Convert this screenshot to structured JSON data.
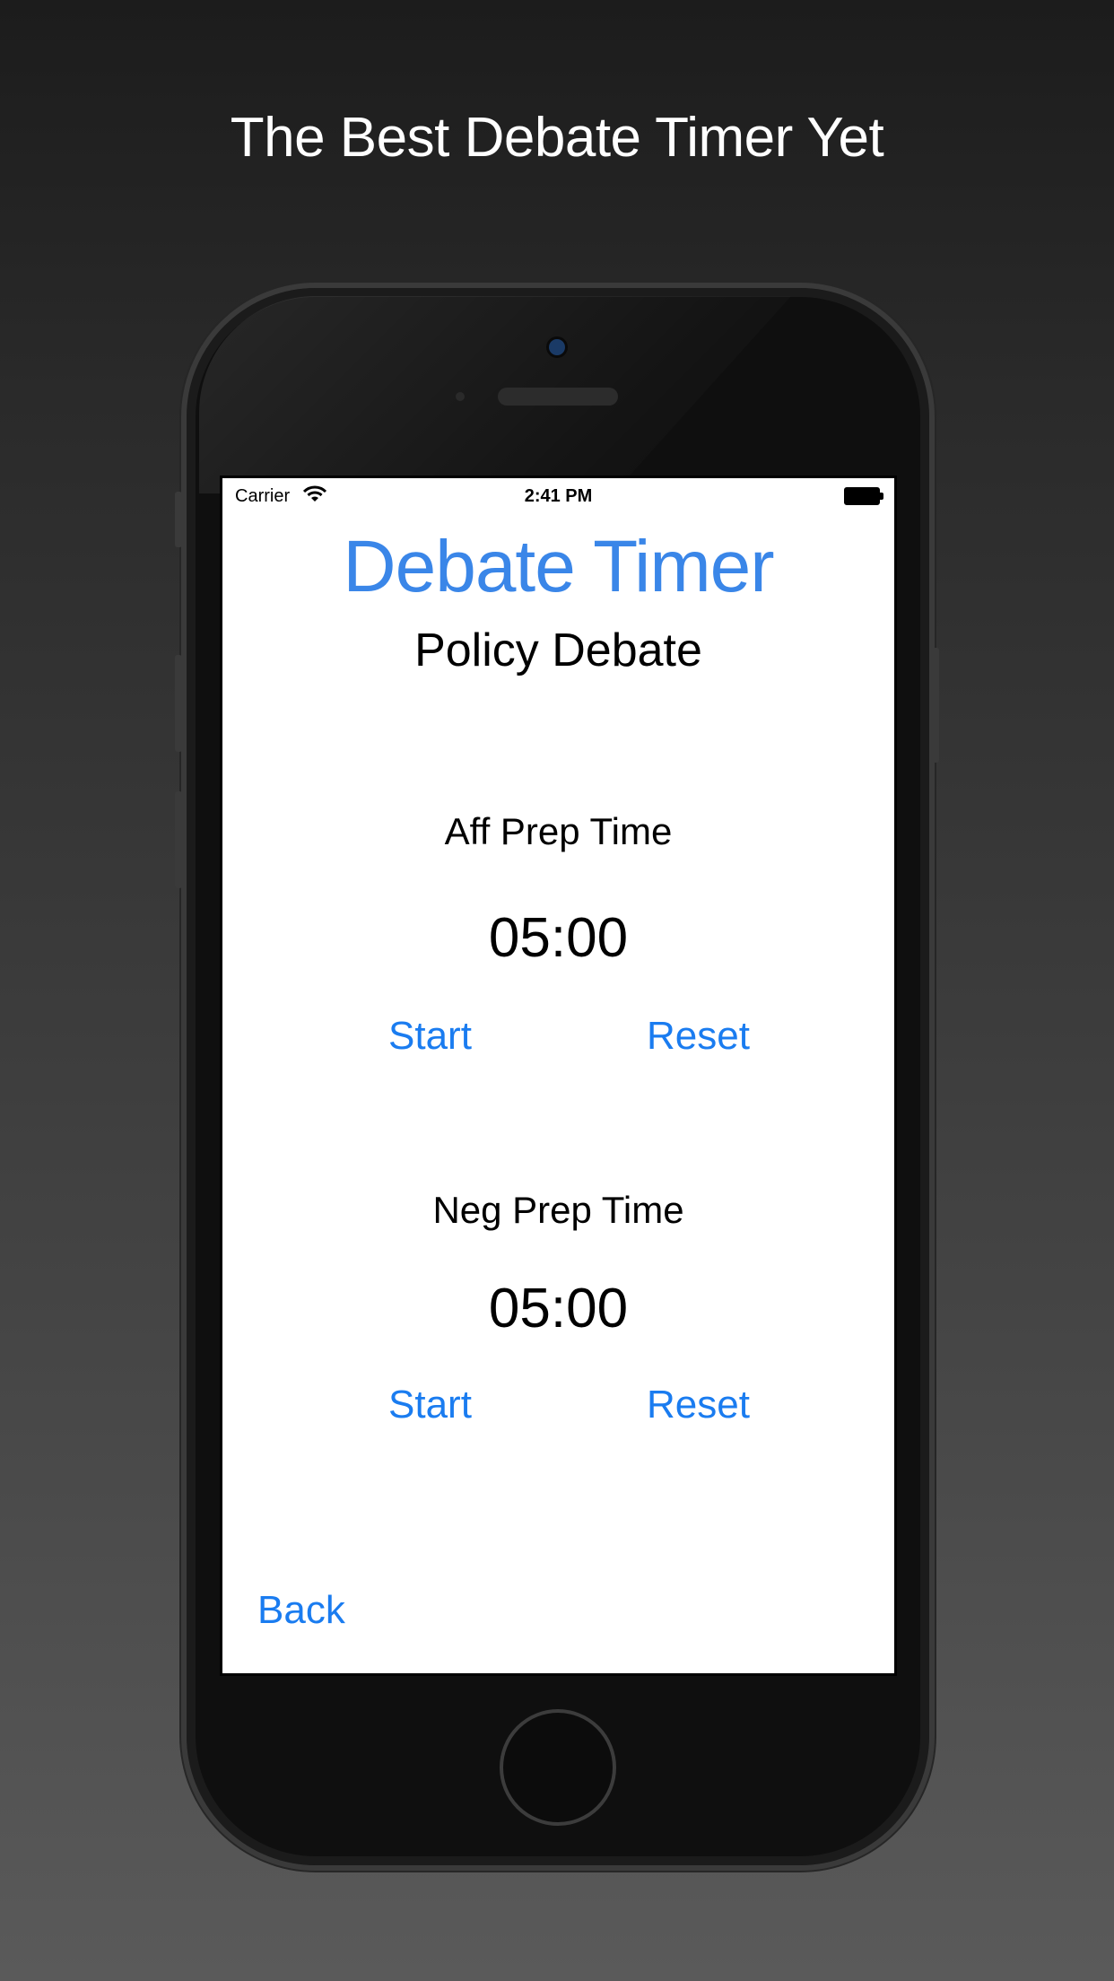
{
  "headline": "The Best Debate Timer Yet",
  "status_bar": {
    "carrier": "Carrier",
    "time": "2:41 PM"
  },
  "app": {
    "title": "Debate Timer",
    "subtitle": "Policy Debate",
    "aff": {
      "label": "Aff Prep Time",
      "time": "05:00",
      "start_label": "Start",
      "reset_label": "Reset"
    },
    "neg": {
      "label": "Neg Prep Time",
      "time": "05:00",
      "start_label": "Start",
      "reset_label": "Reset"
    },
    "back_label": "Back"
  },
  "colors": {
    "title_blue": "#3a86e8",
    "button_blue": "#1a7cf0"
  },
  "icons": [
    "wifi-icon",
    "battery-icon"
  ]
}
